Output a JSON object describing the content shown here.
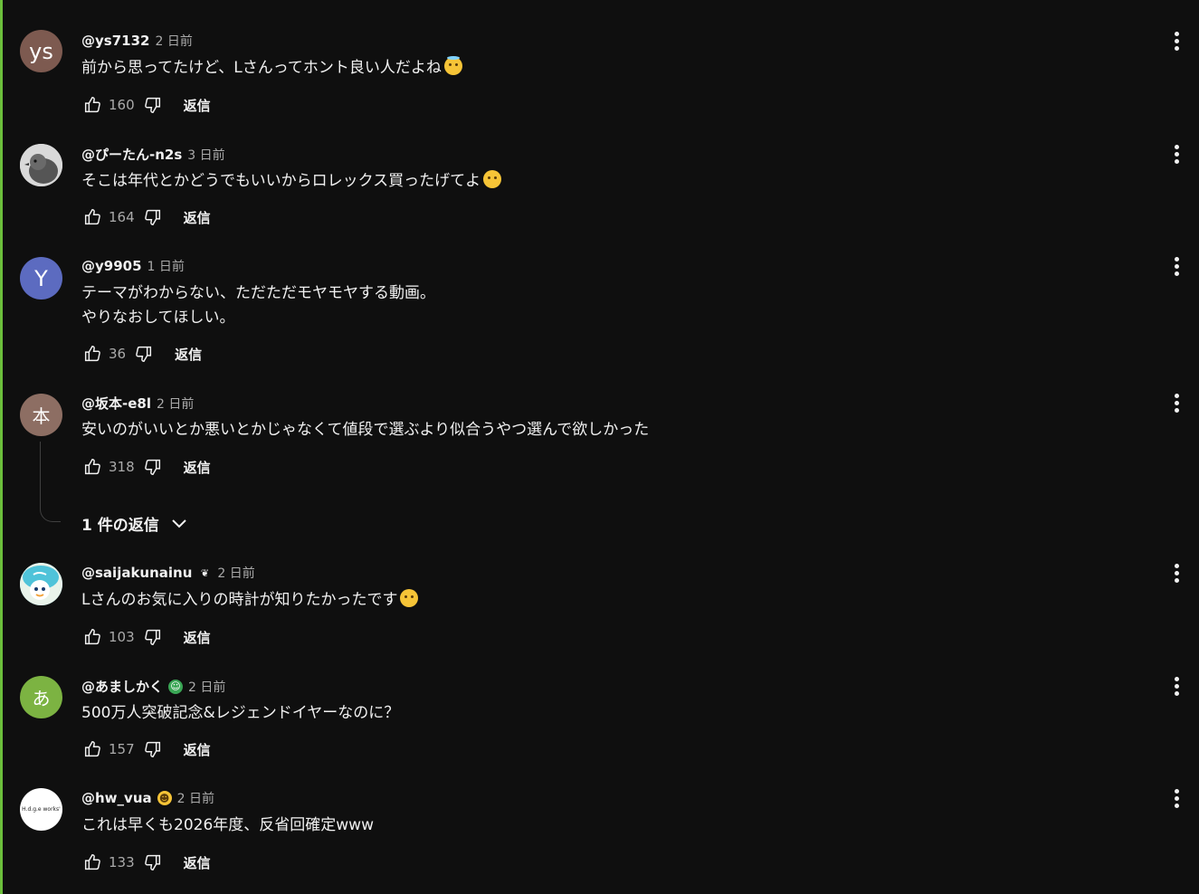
{
  "comments": [
    {
      "author": "@ys7132",
      "time": "2 日前",
      "lines": [
        "前から思ってたけど、Lさんってホント良い人だよね"
      ],
      "emoji": "smiling-halo-emoji",
      "likes": "160",
      "reply_label": "返信",
      "avatar": {
        "text": "ys",
        "color": "#7d5a50"
      }
    },
    {
      "author": "@ぴーたん-n2s",
      "time": "3 日前",
      "lines": [
        "そこは年代とかどうでもいいからロレックス買ったげてよ"
      ],
      "emoji": "pleading-face-emoji",
      "likes": "164",
      "reply_label": "返信",
      "avatar": {
        "text": "",
        "color": "#cfcfcf",
        "icon": "bird-photo-avatar"
      }
    },
    {
      "author": "@y9905",
      "time": "1 日前",
      "lines": [
        "テーマがわからない、ただただモヤモヤする動画。",
        "やりなおしてほしい。"
      ],
      "likes": "36",
      "reply_label": "返信",
      "avatar": {
        "text": "Y",
        "color": "#5c6bc0"
      }
    },
    {
      "author": "@坂本-e8l",
      "time": "2 日前",
      "lines": [
        "安いのがいいとか悪いとかじゃなくて値段で選ぶより似合うやつ選んで欲しかった"
      ],
      "likes": "318",
      "reply_label": "返信",
      "avatar": {
        "text": "本",
        "color": "#8d6e63"
      },
      "replies_label": "1 件の返信"
    },
    {
      "author": "@saijakunainu",
      "time": "2 日前",
      "lines": [
        "Lさんのお気に入りの時計が知りたかったです"
      ],
      "emoji": "pleading-face-emoji",
      "likes": "103",
      "reply_label": "返信",
      "avatar": {
        "text": "",
        "color": "#4fc3d9",
        "icon": "cartoon-character-avatar"
      },
      "badge": "member-badge-icon"
    },
    {
      "author": "@あましかく",
      "time": "2 日前",
      "lines": [
        "500万人突破記念&レジェンドイヤーなのに？"
      ],
      "likes": "157",
      "reply_label": "返信",
      "avatar": {
        "text": "あ",
        "color": "#7cb342"
      },
      "badge": "member-badge-icon"
    },
    {
      "author": "@hw_vua",
      "time": "2 日前",
      "lines": [
        "これは早くも2026年度、反省回確定www"
      ],
      "likes": "133",
      "reply_label": "返信",
      "avatar": {
        "text": "H.d.g.e works'",
        "color": "#ffffff"
      },
      "badge": "member-badge-icon"
    }
  ],
  "colors": {
    "background": "#0f0f0f",
    "accent": "#6cbf3c",
    "text": "#f1f1f1",
    "muted": "#aaaaaa"
  }
}
